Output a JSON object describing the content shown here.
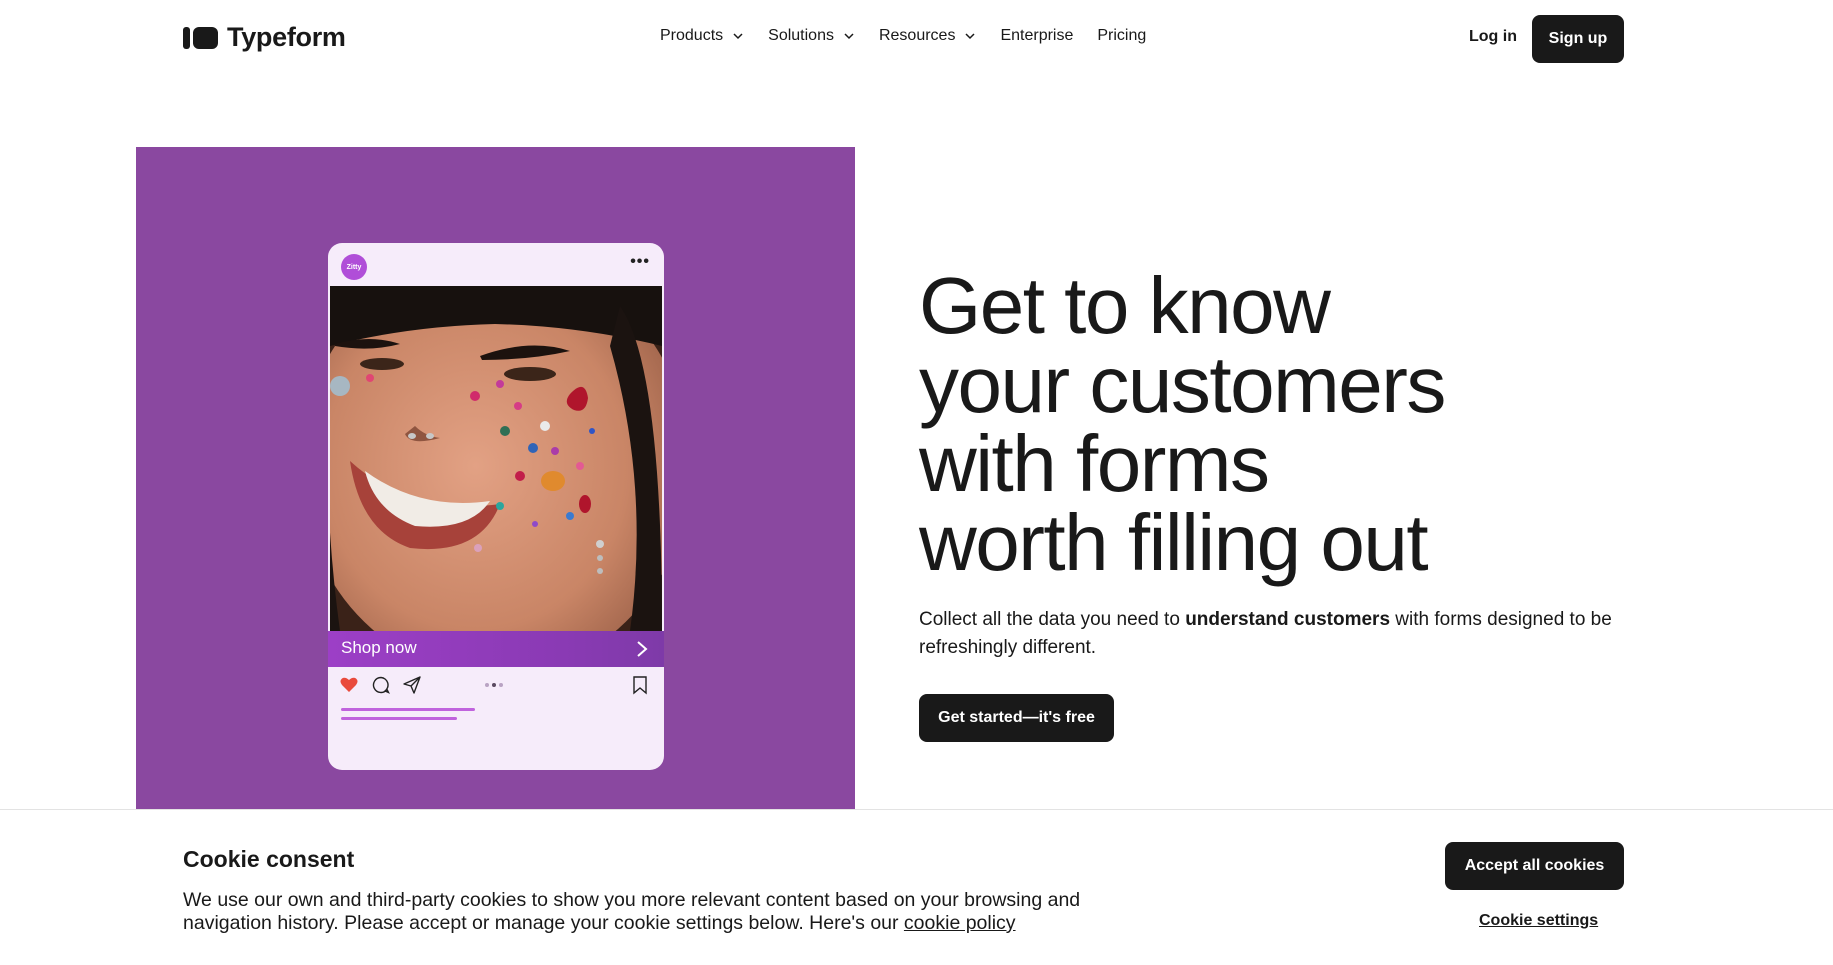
{
  "header": {
    "logo_text": "Typeform",
    "nav": [
      {
        "label": "Products",
        "has_dropdown": true
      },
      {
        "label": "Solutions",
        "has_dropdown": true
      },
      {
        "label": "Resources",
        "has_dropdown": true
      },
      {
        "label": "Enterprise",
        "has_dropdown": false
      },
      {
        "label": "Pricing",
        "has_dropdown": false
      }
    ],
    "login_label": "Log in",
    "signup_label": "Sign up"
  },
  "hero": {
    "background_color": "#8a48a0",
    "phone": {
      "avatar_text": "Zitty",
      "more_icon": "ellipsis-icon",
      "shop_label": "Shop now",
      "icons": [
        "heart-icon",
        "comment-icon",
        "send-icon",
        "bookmark-icon"
      ]
    },
    "headline_lines": [
      "Get to know",
      "your customers",
      "with forms",
      "worth filling out"
    ],
    "sub_before": "Collect all the data you need to ",
    "sub_bold": "understand customers",
    "sub_after": " with forms designed to be refreshingly different.",
    "cta_label": "Get started—it's free"
  },
  "cookie": {
    "title": "Cookie consent",
    "text": "We use our own and third-party cookies to show you more relevant content based on your browsing and navigation history. Please accept or manage your cookie settings below. Here's our ",
    "link_label": "cookie policy",
    "accept_label": "Accept all cookies",
    "settings_label": "Cookie settings"
  }
}
